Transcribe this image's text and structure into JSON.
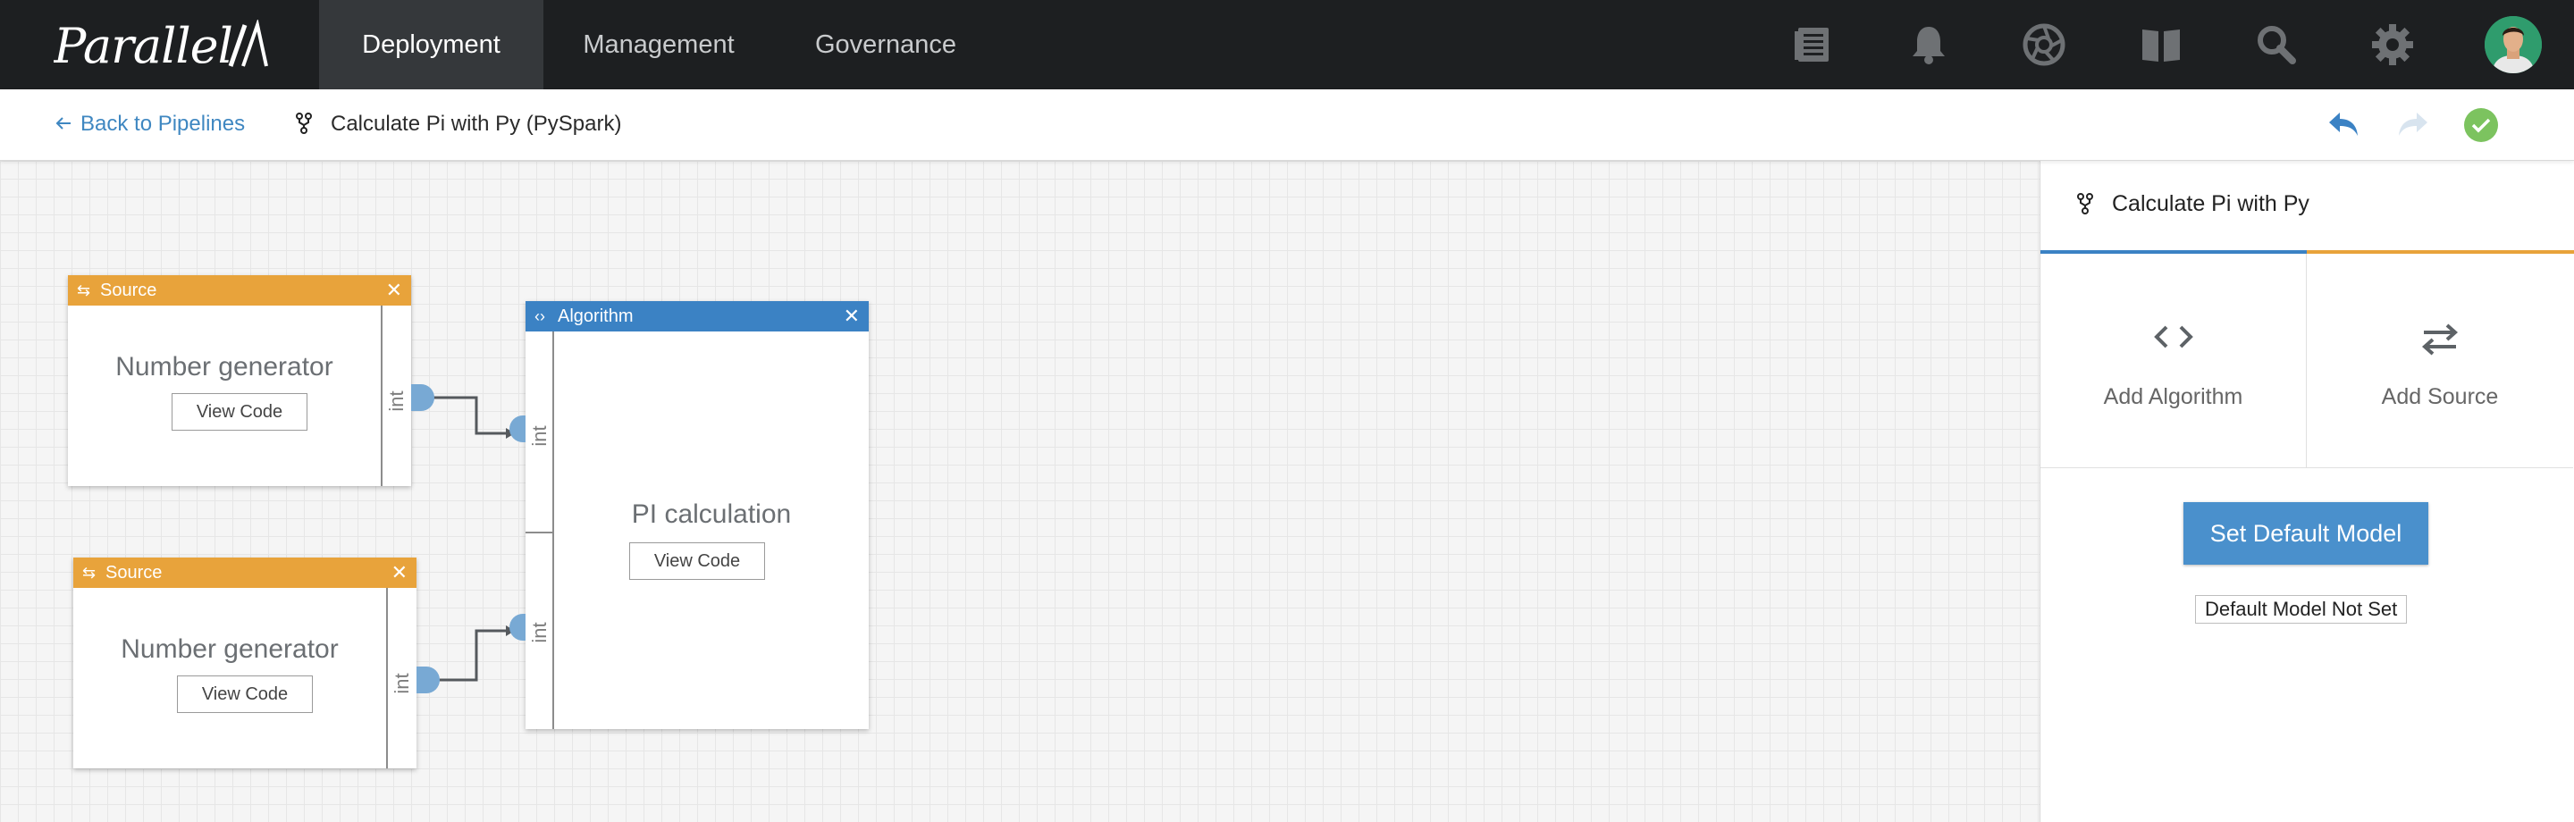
{
  "app": {
    "logo_text": "Parallel/\\"
  },
  "topnav": {
    "tabs": [
      {
        "label": "Deployment",
        "active": true
      },
      {
        "label": "Management",
        "active": false
      },
      {
        "label": "Governance",
        "active": false
      }
    ],
    "icons": [
      "document-list-icon",
      "bell-icon",
      "aperture-icon",
      "book-icon",
      "search-icon",
      "gear-icon",
      "user-avatar"
    ]
  },
  "subheader": {
    "back_label": "Back to Pipelines",
    "pipeline_title": "Calculate Pi with Py (PySpark)",
    "icons": [
      "undo-icon",
      "redo-icon",
      "status-ok-icon"
    ]
  },
  "canvas": {
    "nodes": [
      {
        "type": "Source",
        "name": "Number generator",
        "button": "View Code",
        "port": "int"
      },
      {
        "type": "Algorithm",
        "name": "PI calculation",
        "button": "View Code",
        "ports": [
          "int",
          "int"
        ]
      },
      {
        "type": "Source",
        "name": "Number generator",
        "button": "View Code",
        "port": "int"
      }
    ]
  },
  "panel": {
    "title": "Calculate Pi with Py",
    "tiles": [
      {
        "label": "Add Algorithm",
        "icon": "code-icon"
      },
      {
        "label": "Add Source",
        "icon": "swap-arrows-icon"
      }
    ],
    "set_default_label": "Set Default Model",
    "status_label": "Default Model Not Set"
  },
  "colors": {
    "source_header": "#e8a33b",
    "algorithm_header": "#3b82c4",
    "accent_blue": "#4a90cc",
    "status_green": "#7cc35f",
    "nav_bg": "#1d1f21"
  }
}
